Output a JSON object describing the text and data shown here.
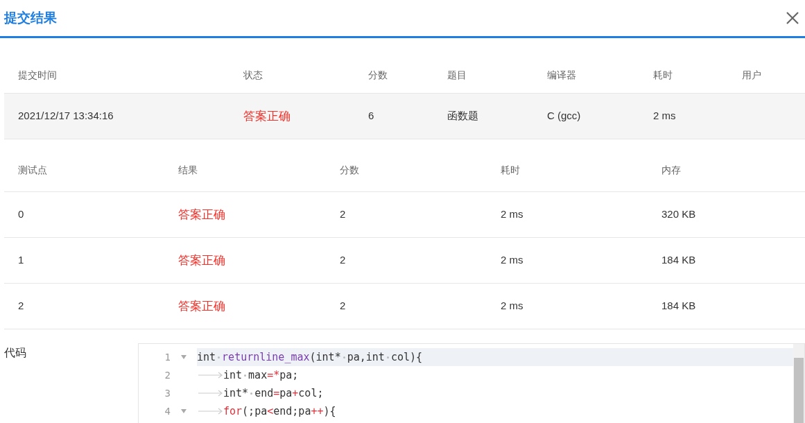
{
  "dialog": {
    "title": "提交结果"
  },
  "summary": {
    "columns": [
      "提交时间",
      "状态",
      "分数",
      "题目",
      "编译器",
      "耗时",
      "用户"
    ],
    "row": [
      {
        "text": "2021/12/17 13:34:16",
        "kind": "plain"
      },
      {
        "text": "答案正确",
        "kind": "status"
      },
      {
        "text": "6",
        "kind": "plain"
      },
      {
        "text": "函数题",
        "kind": "plain"
      },
      {
        "text": "C (gcc)",
        "kind": "plain"
      },
      {
        "text": "2 ms",
        "kind": "plain"
      }
    ]
  },
  "tests": {
    "columns": [
      "测试点",
      "结果",
      "分数",
      "耗时",
      "内存"
    ],
    "rows": [
      [
        "0",
        "答案正确",
        "2",
        "2 ms",
        "320 KB"
      ],
      [
        "1",
        "答案正确",
        "2",
        "2 ms",
        "184 KB"
      ],
      [
        "2",
        "答案正确",
        "2",
        "2 ms",
        "184 KB"
      ]
    ]
  },
  "code": {
    "label": "代码",
    "lines": [
      {
        "number": "1",
        "fold": true,
        "selected": true,
        "tokens": [
          {
            "kind": "plain",
            "text": "int"
          },
          {
            "kind": "space"
          },
          {
            "kind": "function",
            "text": "returnline_max"
          },
          {
            "kind": "plain",
            "text": "(int*"
          },
          {
            "kind": "space"
          },
          {
            "kind": "plain",
            "text": "pa,int"
          },
          {
            "kind": "space"
          },
          {
            "kind": "plain",
            "text": "col){"
          }
        ]
      },
      {
        "number": "2",
        "fold": false,
        "selected": false,
        "tokens": [
          {
            "kind": "tab"
          },
          {
            "kind": "plain",
            "text": "int"
          },
          {
            "kind": "space"
          },
          {
            "kind": "plain",
            "text": "max"
          },
          {
            "kind": "operator",
            "text": "=*"
          },
          {
            "kind": "plain",
            "text": "pa;"
          }
        ]
      },
      {
        "number": "3",
        "fold": false,
        "selected": false,
        "tokens": [
          {
            "kind": "tab"
          },
          {
            "kind": "plain",
            "text": "int*"
          },
          {
            "kind": "space"
          },
          {
            "kind": "plain",
            "text": "end"
          },
          {
            "kind": "operator",
            "text": "="
          },
          {
            "kind": "plain",
            "text": "pa"
          },
          {
            "kind": "operator",
            "text": "+"
          },
          {
            "kind": "plain",
            "text": "col;"
          }
        ]
      },
      {
        "number": "4",
        "fold": true,
        "selected": false,
        "tokens": [
          {
            "kind": "tab"
          },
          {
            "kind": "operator",
            "text": "for"
          },
          {
            "kind": "plain",
            "text": "(;pa"
          },
          {
            "kind": "operator",
            "text": "<"
          },
          {
            "kind": "plain",
            "text": "end;pa"
          },
          {
            "kind": "operator",
            "text": "++"
          },
          {
            "kind": "plain",
            "text": "){"
          }
        ]
      }
    ]
  }
}
